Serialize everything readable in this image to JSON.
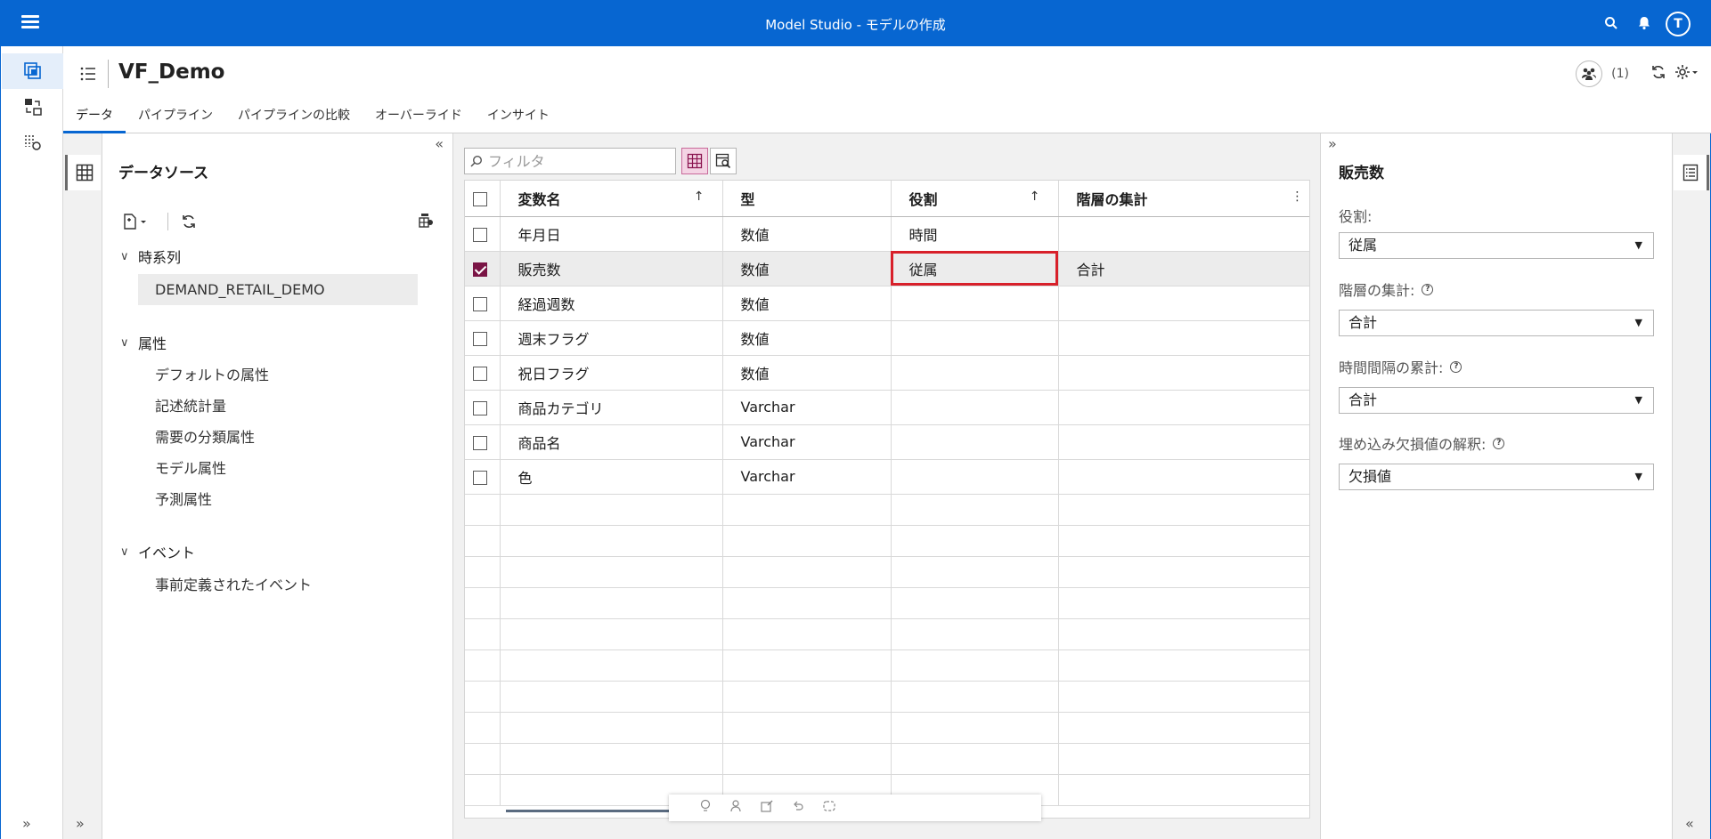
{
  "app": {
    "title": "Model Studio - モデルの作成",
    "user_initial": "T"
  },
  "project": {
    "name": "VF_Demo",
    "collaborators_count": "(1)",
    "tabs": [
      "データ",
      "パイプライン",
      "パイプラインの比較",
      "オーバーライド",
      "インサイト"
    ],
    "active_tab": "データ"
  },
  "datasource": {
    "heading": "データソース",
    "groups": [
      {
        "label": "時系列",
        "items": [
          "DEMAND_RETAIL_DEMO"
        ]
      },
      {
        "label": "属性",
        "items": [
          "デフォルトの属性",
          "記述統計量",
          "需要の分類属性",
          "モデル属性",
          "予測属性"
        ]
      },
      {
        "label": "イベント",
        "items": [
          "事前定義されたイベント"
        ]
      }
    ]
  },
  "grid": {
    "filter_placeholder": "フィルタ",
    "columns": [
      "変数名",
      "型",
      "役割",
      "階層の集計"
    ],
    "rows": [
      {
        "name": "年月日",
        "type": "数値",
        "role": "時間",
        "agg": "",
        "checked": false
      },
      {
        "name": "販売数",
        "type": "数値",
        "role": "従属",
        "agg": "合計",
        "checked": true
      },
      {
        "name": "経過週数",
        "type": "数値",
        "role": "",
        "agg": "",
        "checked": false
      },
      {
        "name": "週末フラグ",
        "type": "数値",
        "role": "",
        "agg": "",
        "checked": false
      },
      {
        "name": "祝日フラグ",
        "type": "数値",
        "role": "",
        "agg": "",
        "checked": false
      },
      {
        "name": "商品カテゴリ",
        "type": "Varchar",
        "role": "",
        "agg": "",
        "checked": false
      },
      {
        "name": "商品名",
        "type": "Varchar",
        "role": "",
        "agg": "",
        "checked": false
      },
      {
        "name": "色",
        "type": "Varchar",
        "role": "",
        "agg": "",
        "checked": false
      }
    ]
  },
  "properties": {
    "heading": "販売数",
    "fields": [
      {
        "label": "役割:",
        "value": "従属",
        "help": false
      },
      {
        "label": "階層の集計:",
        "value": "合計",
        "help": true
      },
      {
        "label": "時間間隔の累計:",
        "value": "合計",
        "help": true
      },
      {
        "label": "埋め込み欠損値の解釈:",
        "value": "欠損値",
        "help": true
      }
    ]
  },
  "colors": {
    "topbar": "#0766d1",
    "checkbox_checked": "#7a1445",
    "highlight": "#d8202a"
  }
}
